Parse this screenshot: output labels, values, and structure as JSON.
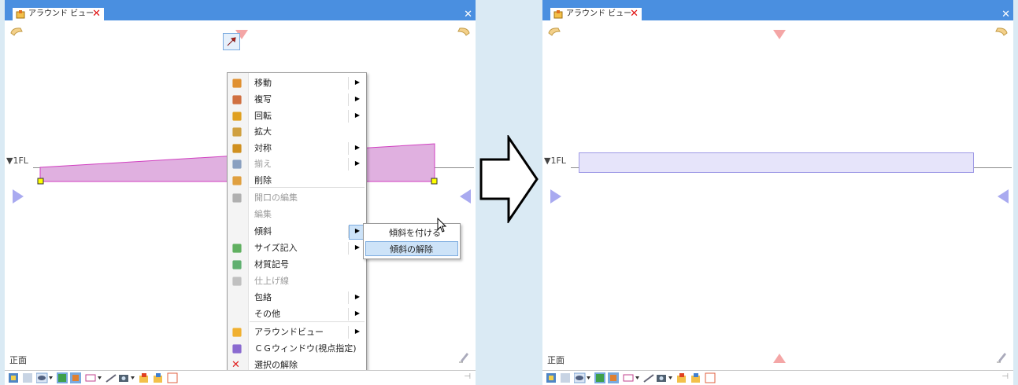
{
  "tab_title": "アラウンド ビュー",
  "level_label": "▼1FL",
  "view_name": "正面",
  "context_menu": {
    "items": [
      {
        "label": "移動",
        "has_submenu": true,
        "disabled": false
      },
      {
        "label": "複写",
        "has_submenu": true,
        "disabled": false
      },
      {
        "label": "回転",
        "has_submenu": true,
        "disabled": false
      },
      {
        "label": "拡大",
        "has_submenu": false,
        "disabled": false
      },
      {
        "label": "対称",
        "has_submenu": true,
        "disabled": false
      },
      {
        "label": "揃え",
        "has_submenu": true,
        "disabled": true
      },
      {
        "label": "削除",
        "has_submenu": false,
        "disabled": false
      },
      {
        "label": "開口の編集",
        "has_submenu": false,
        "disabled": true
      },
      {
        "label": "編集",
        "has_submenu": false,
        "disabled": true
      },
      {
        "label": "傾斜",
        "has_submenu": true,
        "disabled": false
      },
      {
        "label": "サイズ記入",
        "has_submenu": true,
        "disabled": false
      },
      {
        "label": "材質記号",
        "has_submenu": false,
        "disabled": false
      },
      {
        "label": "仕上げ線",
        "has_submenu": false,
        "disabled": true
      },
      {
        "label": "包絡",
        "has_submenu": true,
        "disabled": false
      },
      {
        "label": "その他",
        "has_submenu": true,
        "disabled": false
      },
      {
        "label": "アラウンドビュー",
        "has_submenu": true,
        "disabled": false
      },
      {
        "label": "ＣＧウィンドウ(視点指定)",
        "has_submenu": false,
        "disabled": false
      },
      {
        "label": "選択の解除",
        "has_submenu": false,
        "disabled": false
      }
    ]
  },
  "submenu": {
    "items": [
      {
        "label": "傾斜を付ける"
      },
      {
        "label": "傾斜の解除"
      }
    ]
  },
  "colors": {
    "title_bar": "#4a8fe0",
    "slope_fill": "#e0b0e0",
    "slope_stroke": "#d040c0",
    "flat_fill": "#e6e4fa",
    "flat_stroke": "#9f9ae6",
    "nav_pink": "#f4a6a6",
    "nav_blue": "#a9aaf0"
  }
}
